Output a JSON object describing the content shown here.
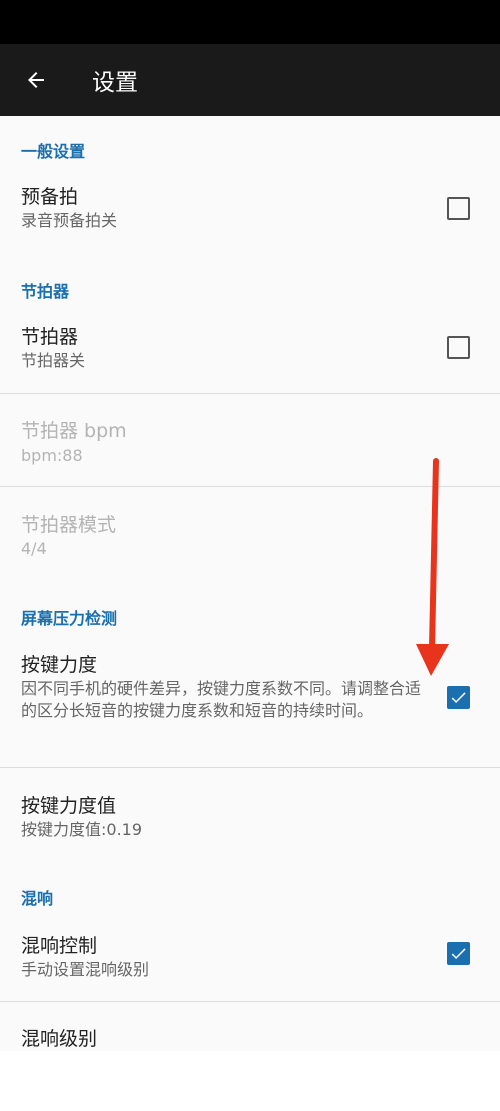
{
  "app_bar": {
    "title": "设置"
  },
  "categories": {
    "general": "一般设置",
    "metronome": "节拍器",
    "pressure": "屏幕压力检测",
    "reverb": "混响"
  },
  "prefs": {
    "precount": {
      "title": "预备拍",
      "summary": "录音预备拍关",
      "checked": false
    },
    "metronome": {
      "title": "节拍器",
      "summary": "节拍器关",
      "checked": false
    },
    "metronome_bpm": {
      "title": "节拍器 bpm",
      "summary": "bpm:88"
    },
    "metronome_mode": {
      "title": "节拍器模式",
      "summary": "4/4"
    },
    "key_force": {
      "title": "按键力度",
      "summary": "因不同手机的硬件差异，按键力度系数不同。请调整合适的区分长短音的按键力度系数和短音的持续时间。",
      "checked": true
    },
    "key_force_value": {
      "title": "按键力度值",
      "summary": "按键力度值:0.19"
    },
    "reverb_control": {
      "title": "混响控制",
      "summary": "手动设置混响级别",
      "checked": true
    },
    "reverb_level": {
      "title": "混响级别"
    }
  },
  "colors": {
    "accent": "#1a6fae",
    "annotation_arrow": "#e8341c"
  }
}
